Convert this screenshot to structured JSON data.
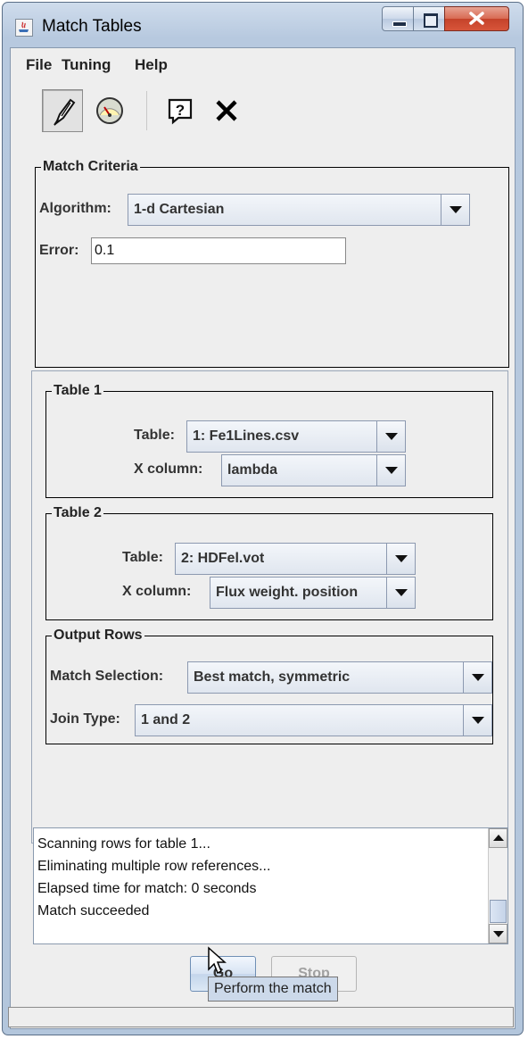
{
  "window": {
    "title": "Match Tables",
    "minimize_icon": "minimize-icon",
    "maximize_icon": "maximize-icon",
    "close_icon": "close-icon"
  },
  "menu": {
    "file": "File",
    "tuning": "Tuning",
    "help": "Help"
  },
  "toolbar": {
    "icons": [
      "feather-pen-icon",
      "gauge-icon",
      "help-bubble-icon",
      "close-x-icon"
    ]
  },
  "match_criteria": {
    "title": "Match Criteria",
    "algorithm_label": "Algorithm:",
    "algorithm_value": "1-d Cartesian",
    "error_label": "Error:",
    "error_value": "0.1"
  },
  "table1": {
    "title": "Table 1",
    "table_label": "Table:",
    "table_value": "1: Fe1Lines.csv",
    "xcol_label": "X column:",
    "xcol_value": "lambda"
  },
  "table2": {
    "title": "Table 2",
    "table_label": "Table:",
    "table_value": "2: HDFel.vot",
    "xcol_label": "X column:",
    "xcol_value": "Flux weight. position"
  },
  "output_rows": {
    "title": "Output Rows",
    "selection_label": "Match Selection:",
    "selection_value": "Best match, symmetric",
    "join_label": "Join Type:",
    "join_value": "1 and 2"
  },
  "log": {
    "lines": [
      "Scanning rows for table 1...",
      "Eliminating multiple row references...",
      "Elapsed time for match: 0 seconds",
      "Match succeeded"
    ]
  },
  "buttons": {
    "go": "Go",
    "stop": "Stop"
  },
  "tooltip": "Perform the match",
  "colors": {
    "title_bar": "#b7c9df",
    "close_button": "#c5422a",
    "panel_bg": "#eeeeee"
  }
}
